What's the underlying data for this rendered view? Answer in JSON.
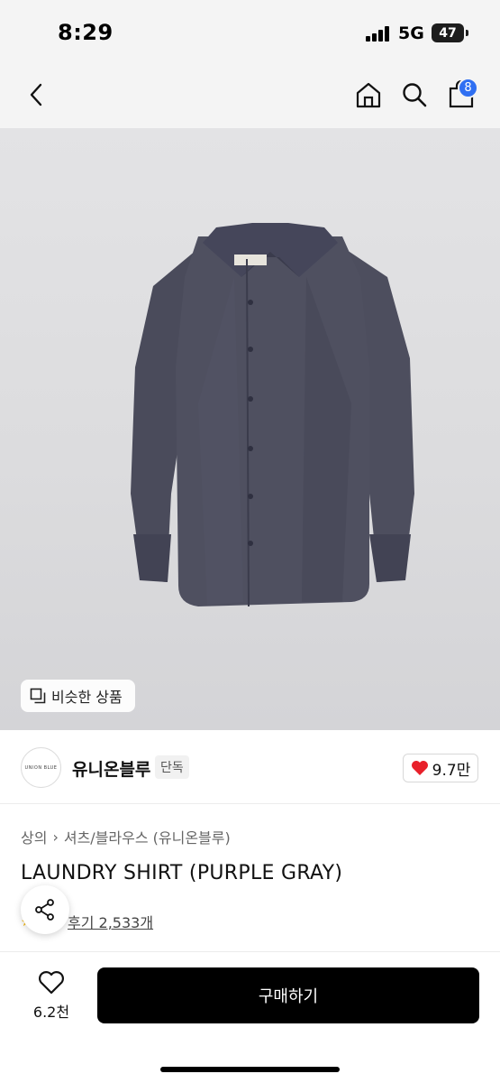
{
  "status_bar": {
    "time": "8:29",
    "network": "5G",
    "battery": "47",
    "battery_level": 0.47
  },
  "nav": {
    "back_icon": "chevron-left-icon",
    "home_icon": "home-icon",
    "search_icon": "search-icon",
    "cart_icon": "shopping-bag-icon",
    "cart_count": "8",
    "badge_color": "#2f6ff2"
  },
  "product_image": {
    "similar_products_label": "비슷한 상품"
  },
  "brand": {
    "logo_text": "UNION BLUE",
    "name": "유니온블루",
    "tag": "단독",
    "likes": "9.7만",
    "like_color": "#e8202a"
  },
  "product": {
    "breadcrumb": [
      "상의",
      "셔츠/블라우스 (유니온블루)"
    ],
    "title": "LAUNDRY SHIRT (PURPLE GRAY)",
    "reviews": "후기 2,533개"
  },
  "bottom_bar": {
    "wish_count": "6.2천",
    "buy_label": "구매하기",
    "buy_color": "#000000"
  }
}
